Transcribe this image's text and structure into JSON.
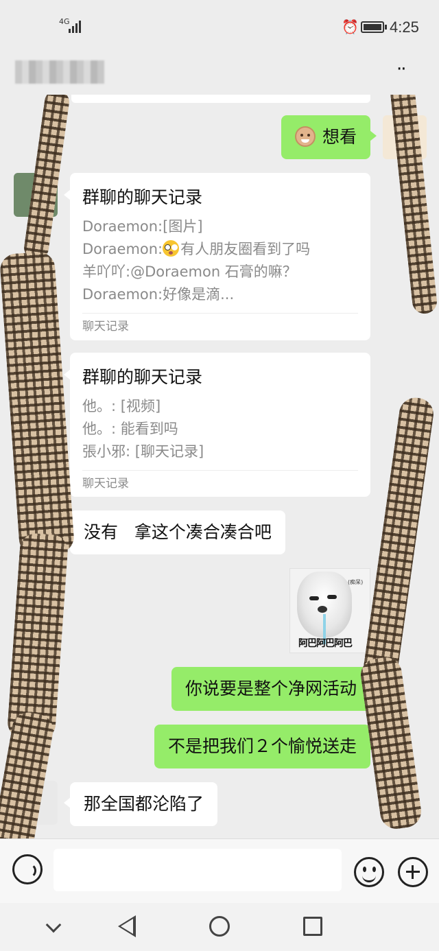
{
  "status_bar": {
    "network": "4G",
    "time": "4:25",
    "icons": [
      "signal-icon",
      "alarm-icon",
      "battery-icon"
    ]
  },
  "header": {
    "more_icon": "more-icon",
    "more_label": "··"
  },
  "messages": [
    {
      "sender": "me",
      "type": "text",
      "emoji": "old-man-emoji",
      "text": "想看"
    },
    {
      "sender": "other",
      "type": "chat-record",
      "title": "群聊的聊天记录",
      "lines": [
        "Doraemon:[图片]",
        "Doraemon:",
        "有人朋友圈看到了吗",
        "羊吖吖:@Doraemon 石膏的嘛？",
        "Doraemon:好像是滴..."
      ],
      "footer": "聊天记录"
    },
    {
      "sender": "other",
      "type": "chat-record",
      "title": "群聊的聊天记录",
      "lines": [
        "他。: [视频]",
        "他。: 能看到吗",
        "張小邪: [聊天记录]"
      ],
      "footer": "聊天记录"
    },
    {
      "sender": "other",
      "type": "text",
      "text": "没有   拿这个凑合凑合吧"
    },
    {
      "sender": "me",
      "type": "sticker",
      "caption": "阿巴阿巴阿巴",
      "tag": "(痴呆)"
    },
    {
      "sender": "me",
      "type": "text",
      "text": "你说要是整个净网活动"
    },
    {
      "sender": "me",
      "type": "text",
      "text": "不是把我们２个愉悦送走"
    },
    {
      "sender": "other",
      "type": "text",
      "text": "那全国都沦陷了"
    }
  ],
  "input_bar": {
    "value": "",
    "icons": [
      "voice-icon",
      "emoji-icon",
      "plus-icon"
    ]
  },
  "nav_bar": {
    "icons": [
      "nav-down-icon",
      "nav-back-icon",
      "nav-home-icon",
      "nav-recent-icon"
    ]
  },
  "colors": {
    "background": "#ededed",
    "my_bubble": "#95ec69",
    "other_bubble": "#ffffff",
    "secondary_text": "#8a8a8a"
  }
}
